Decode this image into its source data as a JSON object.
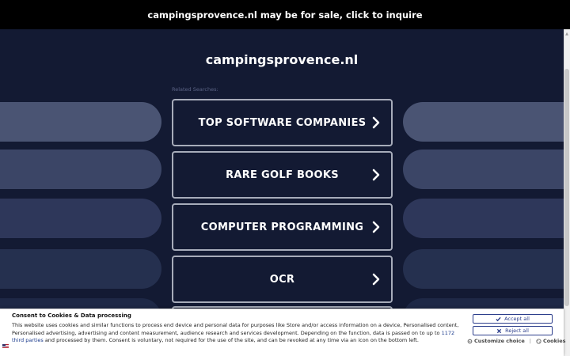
{
  "topbar": {
    "text": "campingsprovence.nl may be for sale, click to inquire"
  },
  "main": {
    "domain": "campingsprovence.nl",
    "related_label": "Related Searches:",
    "searches": [
      {
        "label": "TOP SOFTWARE COMPANIES"
      },
      {
        "label": "RARE GOLF BOOKS"
      },
      {
        "label": "COMPUTER PROGRAMMING"
      },
      {
        "label": "OCR"
      }
    ]
  },
  "cookie": {
    "title": "Consent to Cookies & Data processing",
    "text_before_link": "This website uses cookies and similar functions to process end device and personal data for purposes like Store and/or access information on a device, Personalised content, Personalised advertising, advertising and content measurement, audience research and services development. Depending on the function, data is passed on to up to ",
    "link_text": "1172 third parties",
    "text_after_link": " and processed by them. Consent is voluntary, not required for the use of the site, and can be revoked at any time via an icon on the bottom left.",
    "accept_label": "Accept all",
    "reject_label": "Reject all",
    "customize_label": "Customize choice",
    "separator": "|",
    "cookies_label": "Cookies"
  },
  "colors": {
    "background": "#131a33",
    "topbar": "#000000",
    "button_border": "#a7acba",
    "cookie_accent": "#2c3e8c"
  }
}
